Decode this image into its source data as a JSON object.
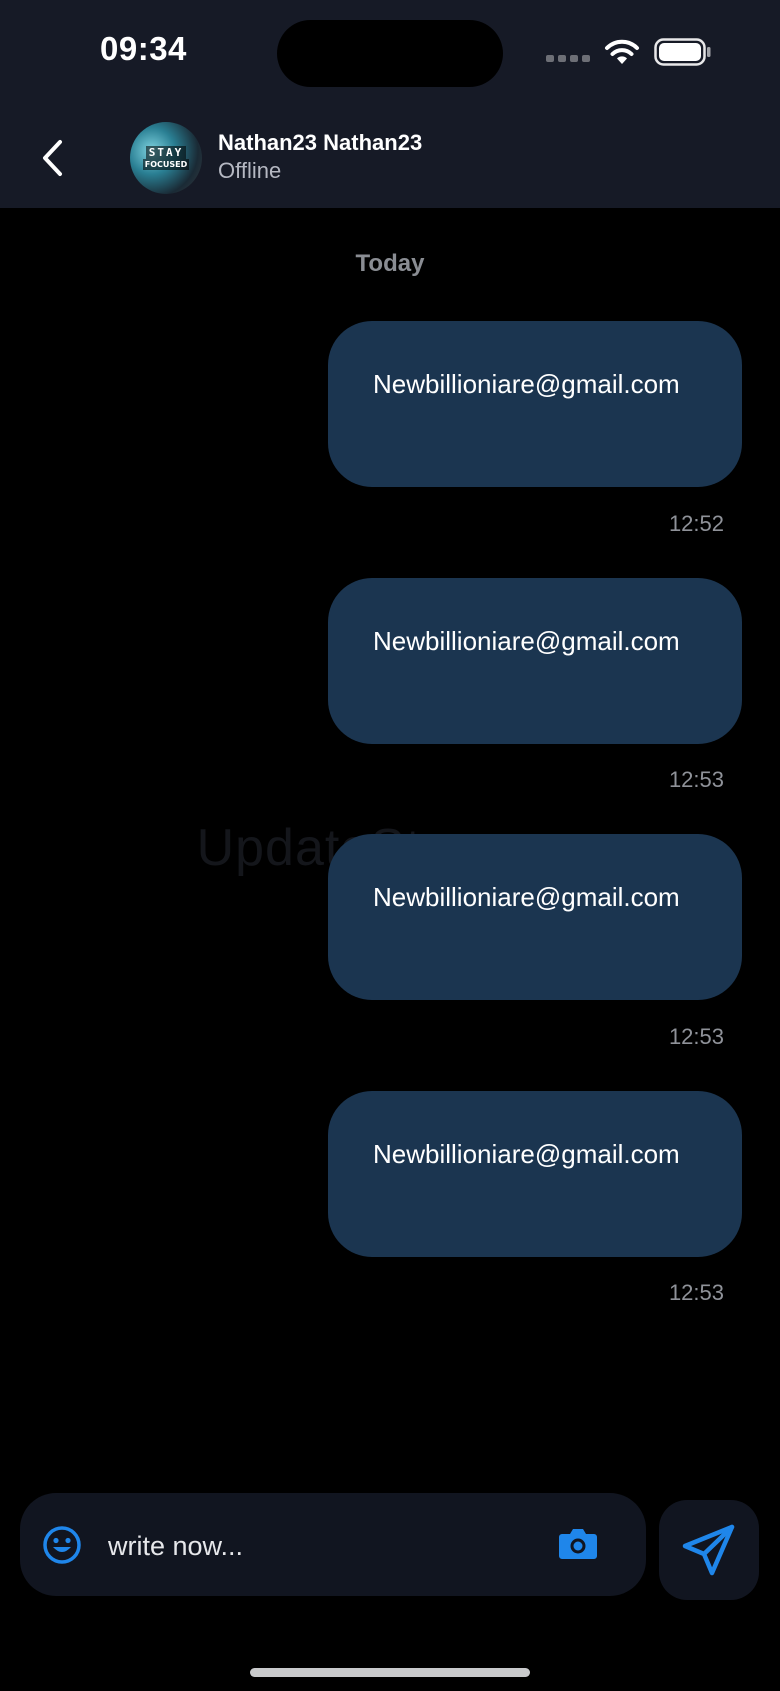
{
  "status_bar": {
    "time": "09:34"
  },
  "header": {
    "contact_name": "Nathan23 Nathan23",
    "contact_status": "Offline",
    "avatar_text_line1": "STAY",
    "avatar_text_line2": "FOCUSED"
  },
  "chat": {
    "date_separator": "Today",
    "watermark": "UpdateStar.com",
    "messages": [
      {
        "text": "Newbillioniare@gmail.com",
        "time": "12:52"
      },
      {
        "text": "Newbillioniare@gmail.com",
        "time": "12:53"
      },
      {
        "text": "Newbillioniare@gmail.com",
        "time": "12:53"
      },
      {
        "text": "Newbillioniare@gmail.com",
        "time": "12:53"
      }
    ]
  },
  "composer": {
    "placeholder": "write now..."
  },
  "icons": {
    "back": "chevron-left-icon",
    "emoji": "smiley-icon",
    "camera": "camera-icon",
    "send": "paper-plane-icon",
    "wifi": "wifi-icon",
    "battery": "battery-icon",
    "signal": "signal-icon"
  },
  "colors": {
    "header_bg": "#161a26",
    "bubble_bg": "#1b3550",
    "accent": "#1f86ea",
    "composer_bg": "#111520"
  }
}
